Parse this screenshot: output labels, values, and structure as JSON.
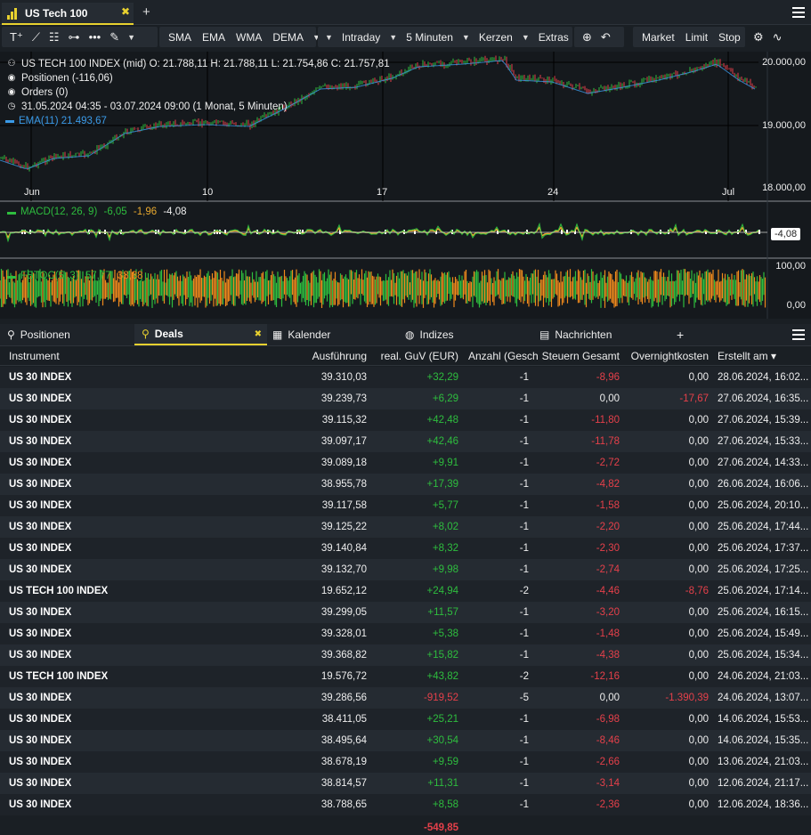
{
  "tab": {
    "title": "US Tech 100",
    "close": "✖",
    "add": "+"
  },
  "toolbar": {
    "indicators": [
      "SMA",
      "EMA",
      "WMA",
      "DEMA"
    ],
    "timeframe": "Intraday",
    "interval": "5 Minuten",
    "chart_type": "Kerzen",
    "extras": "Extras",
    "orders": [
      "Market",
      "Limit",
      "Stop"
    ]
  },
  "chart": {
    "ohlc_line": "US TECH 100 INDEX (mid)  O: 21.788,11  H: 21.788,11  L: 21.754,86  C: 21.757,81",
    "positions": "Positionen (-116,06)",
    "orders": "Orders (0)",
    "range": "31.05.2024 04:35 - 03.07.2024 09:00   (1 Monat, 5 Minuten)",
    "ema": "EMA(11)  21.493,67",
    "y_ticks": [
      "20.000,00",
      "19.000,00",
      "18.000,00"
    ],
    "x_ticks": [
      "Jun",
      "10",
      "17",
      "24",
      "Jul"
    ],
    "macd_name": "MACD(12, 26, 9)",
    "macd_v1": "-6,05",
    "macd_v2": "-1,96",
    "macd_v3": "-4,08",
    "macd_badge": "-4,08",
    "stoch_name": "FSTOC(5, 3)",
    "stoch_v1": "57,77",
    "stoch_v2": "38,88",
    "stoch_top": "100,00",
    "stoch_bottom": "0,00",
    "colors": {
      "ema": "#3a9ae8",
      "macd": "#2ebd3e",
      "signal": "#e8a92f",
      "stoch_k": "#2ebd3e",
      "stoch_d": "#f08a1c"
    }
  },
  "bottom_tabs": {
    "positionen": "Positionen",
    "deals": "Deals",
    "deals_close": "✖",
    "kalender": "Kalender",
    "indizes": "Indizes",
    "nachrichten": "Nachrichten",
    "add": "+"
  },
  "table": {
    "headers": {
      "instrument": "Instrument",
      "ausfuehrung": "Ausführung",
      "guv": "real. GuV (EUR)",
      "anzahl": "Anzahl (Geschl",
      "steuern": "Steuern Gesamt",
      "overnight": "Overnightkosten",
      "erstellt": "Erstellt am ▾"
    },
    "rows": [
      {
        "instrument": "US 30 INDEX",
        "ausfuehrung": "39.310,03",
        "guv": "+32,29",
        "anzahl": "-1",
        "steuern": "-8,96",
        "overnight": "0,00",
        "erstellt": "28.06.2024, 16:02..."
      },
      {
        "instrument": "US 30 INDEX",
        "ausfuehrung": "39.239,73",
        "guv": "+6,29",
        "anzahl": "-1",
        "steuern": "0,00",
        "overnight": "-17,67",
        "erstellt": "27.06.2024, 16:35..."
      },
      {
        "instrument": "US 30 INDEX",
        "ausfuehrung": "39.115,32",
        "guv": "+42,48",
        "anzahl": "-1",
        "steuern": "-11,80",
        "overnight": "0,00",
        "erstellt": "27.06.2024, 15:39..."
      },
      {
        "instrument": "US 30 INDEX",
        "ausfuehrung": "39.097,17",
        "guv": "+42,46",
        "anzahl": "-1",
        "steuern": "-11,78",
        "overnight": "0,00",
        "erstellt": "27.06.2024, 15:33..."
      },
      {
        "instrument": "US 30 INDEX",
        "ausfuehrung": "39.089,18",
        "guv": "+9,91",
        "anzahl": "-1",
        "steuern": "-2,72",
        "overnight": "0,00",
        "erstellt": "27.06.2024, 14:33..."
      },
      {
        "instrument": "US 30 INDEX",
        "ausfuehrung": "38.955,78",
        "guv": "+17,39",
        "anzahl": "-1",
        "steuern": "-4,82",
        "overnight": "0,00",
        "erstellt": "26.06.2024, 16:06..."
      },
      {
        "instrument": "US 30 INDEX",
        "ausfuehrung": "39.117,58",
        "guv": "+5,77",
        "anzahl": "-1",
        "steuern": "-1,58",
        "overnight": "0,00",
        "erstellt": "25.06.2024, 20:10..."
      },
      {
        "instrument": "US 30 INDEX",
        "ausfuehrung": "39.125,22",
        "guv": "+8,02",
        "anzahl": "-1",
        "steuern": "-2,20",
        "overnight": "0,00",
        "erstellt": "25.06.2024, 17:44..."
      },
      {
        "instrument": "US 30 INDEX",
        "ausfuehrung": "39.140,84",
        "guv": "+8,32",
        "anzahl": "-1",
        "steuern": "-2,30",
        "overnight": "0,00",
        "erstellt": "25.06.2024, 17:37..."
      },
      {
        "instrument": "US 30 INDEX",
        "ausfuehrung": "39.132,70",
        "guv": "+9,98",
        "anzahl": "-1",
        "steuern": "-2,74",
        "overnight": "0,00",
        "erstellt": "25.06.2024, 17:25..."
      },
      {
        "instrument": "US TECH 100 INDEX",
        "ausfuehrung": "19.652,12",
        "guv": "+24,94",
        "anzahl": "-2",
        "steuern": "-4,46",
        "overnight": "-8,76",
        "erstellt": "25.06.2024, 17:14..."
      },
      {
        "instrument": "US 30 INDEX",
        "ausfuehrung": "39.299,05",
        "guv": "+11,57",
        "anzahl": "-1",
        "steuern": "-3,20",
        "overnight": "0,00",
        "erstellt": "25.06.2024, 16:15..."
      },
      {
        "instrument": "US 30 INDEX",
        "ausfuehrung": "39.328,01",
        "guv": "+5,38",
        "anzahl": "-1",
        "steuern": "-1,48",
        "overnight": "0,00",
        "erstellt": "25.06.2024, 15:49..."
      },
      {
        "instrument": "US 30 INDEX",
        "ausfuehrung": "39.368,82",
        "guv": "+15,82",
        "anzahl": "-1",
        "steuern": "-4,38",
        "overnight": "0,00",
        "erstellt": "25.06.2024, 15:34..."
      },
      {
        "instrument": "US TECH 100 INDEX",
        "ausfuehrung": "19.576,72",
        "guv": "+43,82",
        "anzahl": "-2",
        "steuern": "-12,16",
        "overnight": "0,00",
        "erstellt": "24.06.2024, 21:03..."
      },
      {
        "instrument": "US 30 INDEX",
        "ausfuehrung": "39.286,56",
        "guv": "-919,52",
        "anzahl": "-5",
        "steuern": "0,00",
        "overnight": "-1.390,39",
        "erstellt": "24.06.2024, 13:07..."
      },
      {
        "instrument": "US 30 INDEX",
        "ausfuehrung": "38.411,05",
        "guv": "+25,21",
        "anzahl": "-1",
        "steuern": "-6,98",
        "overnight": "0,00",
        "erstellt": "14.06.2024, 15:53..."
      },
      {
        "instrument": "US 30 INDEX",
        "ausfuehrung": "38.495,64",
        "guv": "+30,54",
        "anzahl": "-1",
        "steuern": "-8,46",
        "overnight": "0,00",
        "erstellt": "14.06.2024, 15:35..."
      },
      {
        "instrument": "US 30 INDEX",
        "ausfuehrung": "38.678,19",
        "guv": "+9,59",
        "anzahl": "-1",
        "steuern": "-2,66",
        "overnight": "0,00",
        "erstellt": "13.06.2024, 21:03..."
      },
      {
        "instrument": "US 30 INDEX",
        "ausfuehrung": "38.814,57",
        "guv": "+11,31",
        "anzahl": "-1",
        "steuern": "-3,14",
        "overnight": "0,00",
        "erstellt": "12.06.2024, 21:17..."
      },
      {
        "instrument": "US 30 INDEX",
        "ausfuehrung": "38.788,65",
        "guv": "+8,58",
        "anzahl": "-1",
        "steuern": "-2,36",
        "overnight": "0,00",
        "erstellt": "12.06.2024, 18:36..."
      }
    ],
    "total_guv": "-549,85"
  }
}
